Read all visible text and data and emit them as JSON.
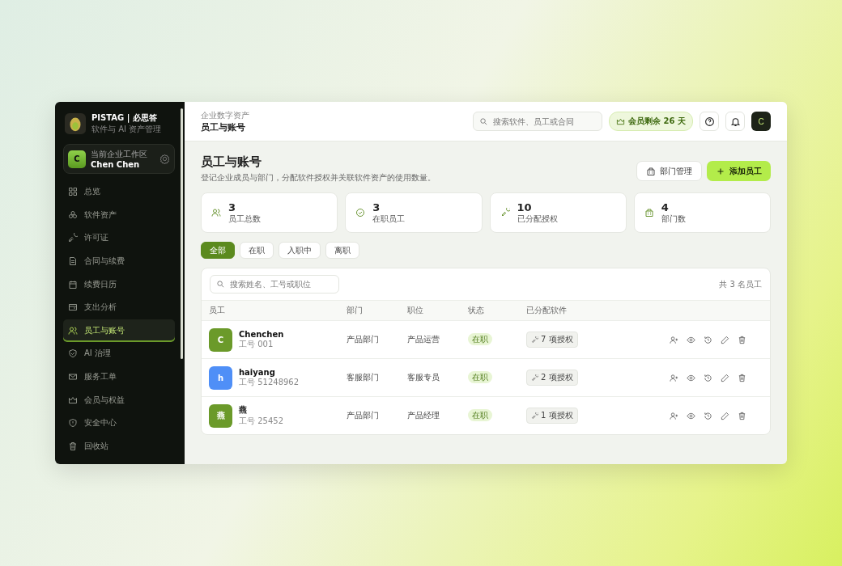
{
  "brand": {
    "name": "PISTAG | 必思答",
    "tagline": "软件与 AI 资产管理"
  },
  "workspace": {
    "avatar": "C",
    "label": "当前企业工作区",
    "user": "Chen Chen"
  },
  "sidebar": {
    "items": [
      {
        "label": "总览",
        "selected": false
      },
      {
        "label": "软件资产",
        "selected": false
      },
      {
        "label": "许可证",
        "selected": false
      },
      {
        "label": "合同与续费",
        "selected": false
      },
      {
        "label": "续费日历",
        "selected": false
      },
      {
        "label": "支出分析",
        "selected": false
      },
      {
        "label": "员工与账号",
        "selected": true
      },
      {
        "label": "AI 治理",
        "selected": false
      },
      {
        "label": "服务工单",
        "selected": false
      },
      {
        "label": "会员与权益",
        "selected": false
      },
      {
        "label": "安全中心",
        "selected": false
      },
      {
        "label": "回收站",
        "selected": false
      }
    ]
  },
  "header": {
    "breadcrumb": "企业数字资产",
    "title": "员工与账号",
    "search": {
      "placeholder": "搜索软件、员工或合同"
    },
    "membership": "会员剩余 26 天",
    "avatar": "C"
  },
  "page": {
    "title": "员工与账号",
    "description": "登记企业成员与部门，分配软件授权并关联软件资产的使用数量。",
    "buttons": [
      {
        "label": "部门管理",
        "kind": "secondary"
      },
      {
        "label": "添加员工",
        "kind": "primary"
      }
    ]
  },
  "stats": [
    {
      "value": "3",
      "label": "员工总数"
    },
    {
      "value": "3",
      "label": "在职员工"
    },
    {
      "value": "10",
      "label": "已分配授权"
    },
    {
      "value": "4",
      "label": "部门数"
    }
  ],
  "filters": [
    {
      "label": "全部",
      "selected": true
    },
    {
      "label": "在职",
      "selected": false
    },
    {
      "label": "入职中",
      "selected": false
    },
    {
      "label": "离职",
      "selected": false
    }
  ],
  "table": {
    "search": {
      "placeholder": "搜索姓名、工号或职位"
    },
    "count": "共 3 名员工",
    "columns": [
      "员工",
      "部门",
      "职位",
      "状态",
      "已分配软件"
    ],
    "rows": [
      {
        "avatar": "C",
        "color": "#6b9a2a",
        "name": "Chenchen",
        "id": "工号 001",
        "department": "产品部门",
        "position": "产品运营",
        "status": "在职",
        "licenses": "7 项授权"
      },
      {
        "avatar": "h",
        "color": "#4f8ff7",
        "name": "haiyang",
        "id": "工号 51248962",
        "department": "客服部门",
        "position": "客服专员",
        "status": "在职",
        "licenses": "2 项授权"
      },
      {
        "avatar": "燕",
        "color": "#6b9a2a",
        "name": "燕",
        "id": "工号 25452",
        "department": "产品部门",
        "position": "产品经理",
        "status": "在职",
        "licenses": "1 项授权"
      }
    ]
  }
}
